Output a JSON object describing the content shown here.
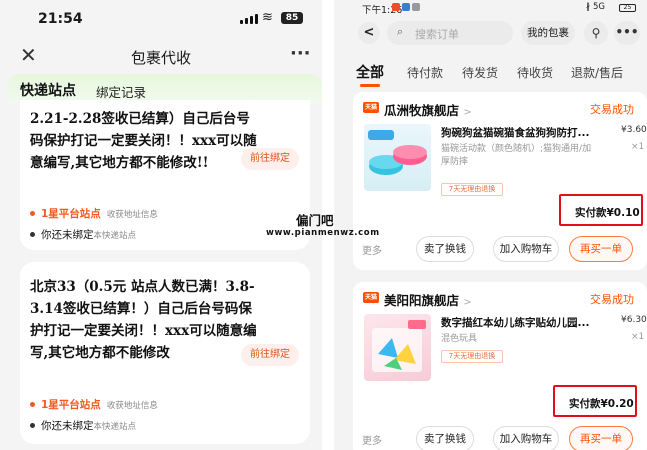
{
  "left": {
    "status_time": "21:54",
    "battery": "85",
    "nav_title": "包裹代收",
    "close_glyph": "✕",
    "more_glyph": "···",
    "tabs": [
      "快递站点",
      "绑定记录"
    ],
    "cards": [
      {
        "text": "2.21-2.28签收已结算）自己后台号码保护打记一定要关闭！！xxx可以随意编写,其它地方都不能修改!!",
        "button": "前往绑定",
        "station_name": "1星平台站点",
        "station_sub": "收获地址信息",
        "bind_status": "你还未绑定",
        "bind_sub": "本快递站点"
      },
      {
        "text": "北京33（0.5元 站点人数已满！3.8-3.14签收已结算！）自己后台号码保护打记一定要关闭！！xxx可以随意编写,其它地方都不能修改",
        "button": "前往绑定",
        "station_name": "1星平台站点",
        "station_sub": "收获地址信息",
        "bind_status": "你还未绑定",
        "bind_sub": "本快递站点"
      }
    ]
  },
  "watermark": {
    "cn": "偏门吧",
    "url": "www.pianmenwz.com"
  },
  "right": {
    "status_time": "下午1:26",
    "status_right": "∦ 5G",
    "battery": "25",
    "back_glyph": "<",
    "search_placeholder": "搜索订单",
    "my_packages": "我的包裹",
    "filter_glyph": "⚲",
    "more_glyph": "•••",
    "tabs": [
      "全部",
      "待付款",
      "待发货",
      "待收货",
      "退款/售后"
    ],
    "orders": [
      {
        "shop_badge": "天猫",
        "shop": "瓜洲牧旗舰店",
        "chevron": ">",
        "status": "交易成功",
        "product": "狗碗狗盆猫碗猫食盆狗狗防打...",
        "spec": "猫碗活动款（颜色随机）;猫狗通用/加厚防摔",
        "tag": "7天无理由退换",
        "price": "¥3.60",
        "qty": "×1",
        "paid_label": "实付款¥0.10",
        "more": "更多",
        "btn1": "卖了换钱",
        "btn2": "加入购物车",
        "btn3": "再买一单"
      },
      {
        "shop_badge": "天猫",
        "shop": "美阳阳旗舰店",
        "chevron": ">",
        "status": "交易成功",
        "product": "数字描红本幼儿练字贴幼儿园...",
        "spec": "混色玩具",
        "tag": "7天无理由退换",
        "price": "¥6.30",
        "qty": "×1",
        "paid_label": "实付款¥0.20",
        "more": "更多",
        "btn1": "卖了换钱",
        "btn2": "加入购物车",
        "btn3": "再买一单"
      }
    ]
  }
}
